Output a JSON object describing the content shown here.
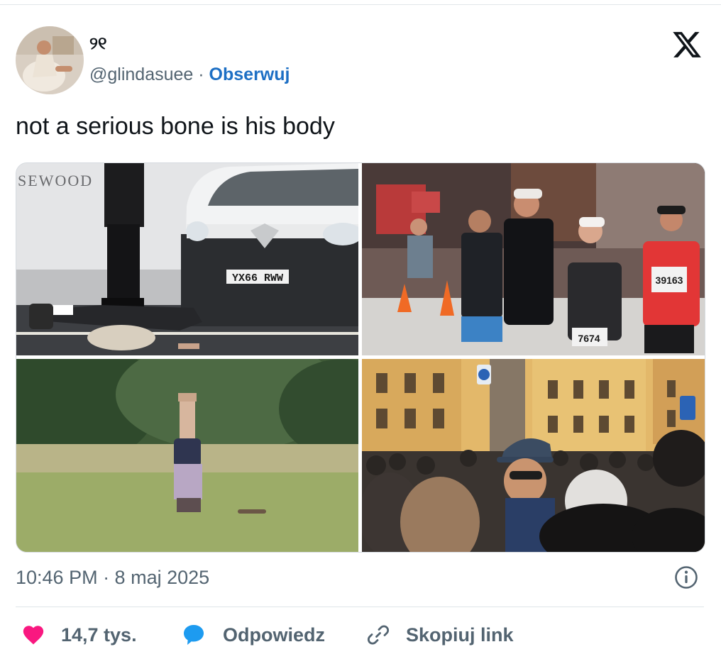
{
  "author": {
    "display_name": "୨୧",
    "handle": "@glindasuee",
    "separator": " · ",
    "follow_label": "Obserwuj"
  },
  "tweet": {
    "text": "not a serious bone is his body",
    "timestamp": "10:46 PM · 8 maj 2025"
  },
  "media": {
    "photo1": {
      "sign_text": "SEWOOD",
      "plate_text": "YX66 RWW"
    },
    "photo2": {
      "bib_1": "39163",
      "bib_2": "7674"
    },
    "photo3": {},
    "photo4": {}
  },
  "actions": {
    "like_count": "14,7 tys.",
    "reply_label": "Odpowiedz",
    "copy_link_label": "Skopiuj link"
  },
  "colors": {
    "accent": "#1d6fc4",
    "heart": "#f91880",
    "muted_text": "#536471",
    "reply_icon": "#1d9bf0"
  },
  "icons": {
    "brand": "x-logo-icon",
    "info": "info-icon",
    "like": "heart-icon",
    "reply": "speech-bubble-icon",
    "copy": "link-icon"
  }
}
